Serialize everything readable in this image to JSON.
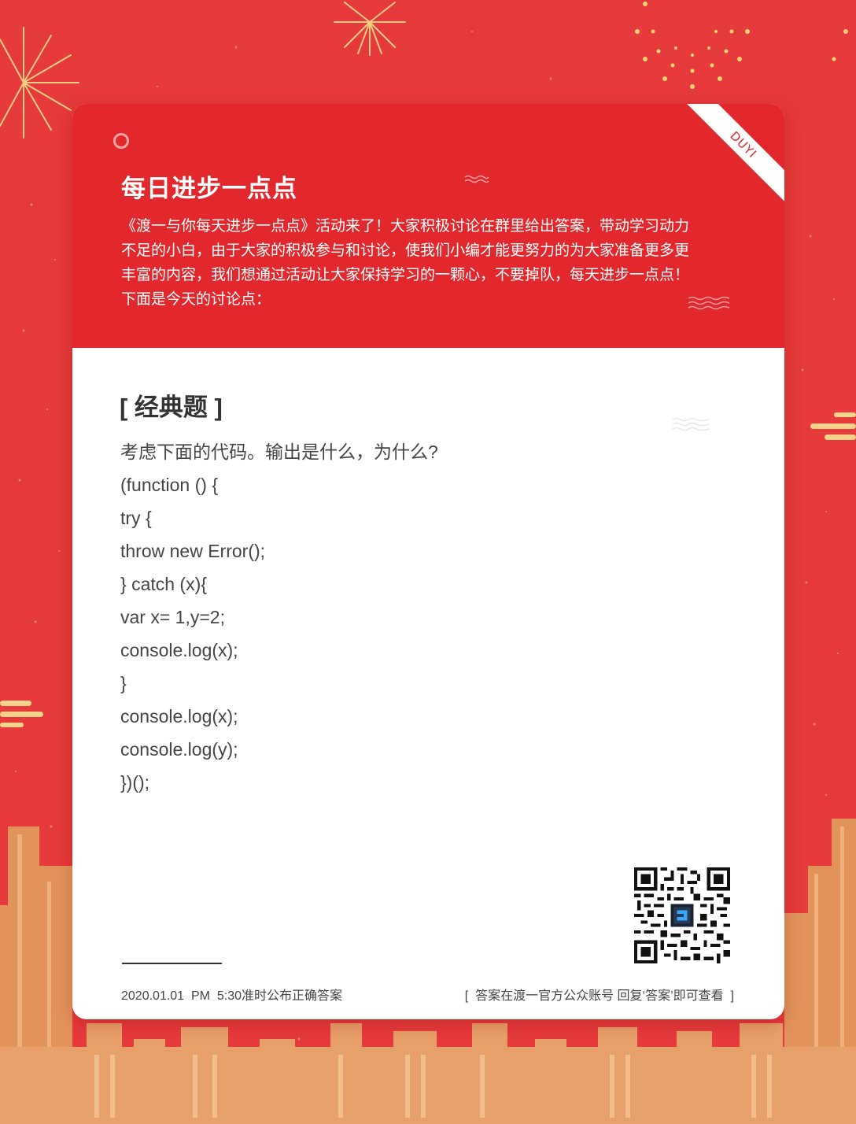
{
  "colors": {
    "background": "#e63a3c",
    "header": "#e3282d",
    "card": "#ffffff",
    "text_dark": "#333333",
    "gold": "#f3c86a",
    "building": "#e0955c"
  },
  "card": {
    "ribbon_label": "DUYI",
    "title": "每日进步一点点",
    "intro": "《渡一与你每天进步一点点》活动来了！大家积极讨论在群里给出答案，带动学习动力不足的小白，由于大家的积极参与和讨论，使我们小编才能更努力的为大家准备更多更丰富的内容，我们想通过活动让大家保持学习的一颗心，不要掉队，每天进步一点点！下面是今天的讨论点：",
    "section_title": "[ 经典题 ]",
    "question": "考虑下面的代码。输出是什么，为什么?",
    "code_lines": [
      "(function () {",
      "try {",
      "throw new Error();",
      "} catch (x){",
      "var x= 1,y=2;",
      "console.log(x);",
      "}",
      "console.log(x);",
      "console.log(y);",
      "})();"
    ],
    "footer_left": "2020.01.01  PM  5:30准时公布正确答案",
    "footer_right": "[  答案在渡一官方公众账号 回复‘答案’即可查看  ]"
  }
}
